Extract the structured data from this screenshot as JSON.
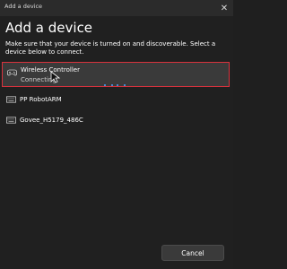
{
  "window": {
    "title": "Add a device",
    "close_glyph": "✕"
  },
  "main": {
    "heading": "Add a device",
    "instructions": "Make sure that your device is turned on and discoverable. Select a device below to connect."
  },
  "devices": [
    {
      "name": "Wireless Controller",
      "status": "Connecting",
      "icon": "gamepad-icon",
      "selected": true
    },
    {
      "name": "PP RobotARM",
      "status": "",
      "icon": "keyboard-icon",
      "selected": false
    },
    {
      "name": "Govee_H5179_486C",
      "status": "",
      "icon": "keyboard-icon",
      "selected": false
    }
  ],
  "footer": {
    "cancel_label": "Cancel"
  },
  "colors": {
    "background": "#202020",
    "selection_border": "#d8323d",
    "accent": "#4ea1ff"
  }
}
